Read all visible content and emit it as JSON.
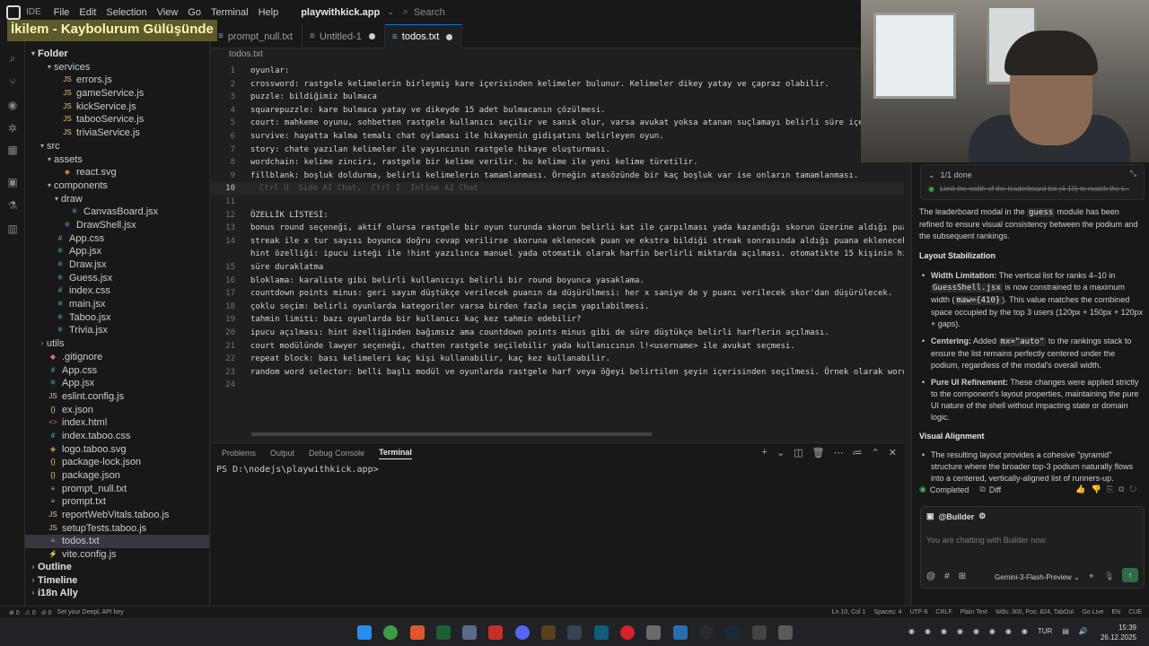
{
  "titlebar": {
    "ide_label": "IDE",
    "menus": [
      "File",
      "Edit",
      "Selection",
      "View",
      "Go",
      "Terminal",
      "Help"
    ],
    "project": "playwithkick.app",
    "search_placeholder": "Search"
  },
  "banner": "İkilem - Kaybolurum Gülüşünde",
  "sidebar": {
    "header": "Explorer",
    "folder_root": "Folder",
    "items": [
      {
        "label": "services",
        "kind": "folder-open",
        "indent": 1
      },
      {
        "label": "errors.js",
        "kind": "js",
        "indent": 2
      },
      {
        "label": "gameService.js",
        "kind": "js",
        "indent": 2
      },
      {
        "label": "kickService.js",
        "kind": "js",
        "indent": 2
      },
      {
        "label": "tabooService.js",
        "kind": "js",
        "indent": 2
      },
      {
        "label": "triviaService.js",
        "kind": "js",
        "indent": 2
      },
      {
        "label": "src",
        "kind": "folder-open",
        "indent": 0
      },
      {
        "label": "assets",
        "kind": "folder-open",
        "indent": 1
      },
      {
        "label": "react.svg",
        "kind": "svg",
        "indent": 2
      },
      {
        "label": "components",
        "kind": "folder-open",
        "indent": 1
      },
      {
        "label": "draw",
        "kind": "folder-open",
        "indent": 2
      },
      {
        "label": "CanvasBoard.jsx",
        "kind": "jsx",
        "indent": 3
      },
      {
        "label": "DrawShell.jsx",
        "kind": "jsx",
        "indent": 2
      },
      {
        "label": "App.css",
        "kind": "css",
        "indent": 1
      },
      {
        "label": "App.jsx",
        "kind": "jsx",
        "indent": 1
      },
      {
        "label": "Draw.jsx",
        "kind": "jsx",
        "indent": 1
      },
      {
        "label": "Guess.jsx",
        "kind": "jsx",
        "indent": 1
      },
      {
        "label": "index.css",
        "kind": "css",
        "indent": 1
      },
      {
        "label": "main.jsx",
        "kind": "jsx",
        "indent": 1
      },
      {
        "label": "Taboo.jsx",
        "kind": "jsx",
        "indent": 1
      },
      {
        "label": "Trivia.jsx",
        "kind": "jsx",
        "indent": 1
      },
      {
        "label": "utils",
        "kind": "folder-closed",
        "indent": 0
      },
      {
        "label": ".gitignore",
        "kind": "git",
        "indent": 0
      },
      {
        "label": "App.css",
        "kind": "css",
        "indent": 0
      },
      {
        "label": "App.jsx",
        "kind": "jsx",
        "indent": 0
      },
      {
        "label": "eslint.config.js",
        "kind": "js",
        "indent": 0
      },
      {
        "label": "ex.json",
        "kind": "json",
        "indent": 0
      },
      {
        "label": "index.html",
        "kind": "html",
        "indent": 0
      },
      {
        "label": "index.taboo.css",
        "kind": "css",
        "indent": 0
      },
      {
        "label": "logo.taboo.svg",
        "kind": "svg",
        "indent": 0
      },
      {
        "label": "package-lock.json",
        "kind": "json",
        "indent": 0
      },
      {
        "label": "package.json",
        "kind": "json",
        "indent": 0
      },
      {
        "label": "prompt_null.txt",
        "kind": "txt",
        "indent": 0
      },
      {
        "label": "prompt.txt",
        "kind": "txt",
        "indent": 0
      },
      {
        "label": "reportWebVitals.taboo.js",
        "kind": "js",
        "indent": 0
      },
      {
        "label": "setupTests.taboo.js",
        "kind": "js",
        "indent": 0
      },
      {
        "label": "todos.txt",
        "kind": "txt",
        "indent": 0,
        "selected": true
      },
      {
        "label": "vite.config.js",
        "kind": "vite",
        "indent": 0
      }
    ],
    "sections": [
      "Outline",
      "Timeline",
      "i18n Ally"
    ]
  },
  "tabs": [
    {
      "label": "prompt_null.txt",
      "active": false,
      "dirty": false
    },
    {
      "label": "Untitled-1",
      "active": false,
      "dirty": true
    },
    {
      "label": "todos.txt",
      "active": true,
      "dirty": true
    }
  ],
  "breadcrumb": "todos.txt",
  "editor": {
    "current_line": 10,
    "lines": [
      "oyunlar:",
      "crossword: rastgele kelimelerin birleşmiş kare içerisinden kelimeler bulunur. Kelimeler dikey yatay ve çapraz olabilir.",
      "puzzle: bildiğimiz bulmaca",
      "squarepuzzle: kare bulmaca yatay ve dikeyde 15 adet bulmacanın çözülmesi.",
      "court: mahkeme oyunu, sohbetten rastgele kullanıcı seçilir ve sanık olur, varsa avukat yoksa atanan suçlamayı belirli süre içerisinde",
      "survive: hayatta kalma temalı chat oylaması ile hikayenin gidişatını belirleyen oyun.",
      "story: chate yazılan kelimeler ile yayıncının rastgele hikaye oluşturması.",
      "wordchain: kelime zinciri, rastgele bir kelime verilir. bu kelime ile yeni kelime türetilir.",
      "fillblank: boşluk doldurma, belirli kelimelerin tamamlanması. Örneğin atasözünde bir kaç boşluk var ise onların tamamlanması.",
      "",
      "",
      "ÖZELLİK LİSTESİ:",
      "bonus round seçeneği, aktif olursa rastgele bir oyun turunda skorun belirli kat ile çarpılması yada kazandığı skorun üzerine aldığı puan ile",
      "streak ile x tur sayısı boyunca doğru cevap verilirse skoruna eklenecek puan ve ekstra bildiği streak sonrasında aldığı puana eklenecek; 3 round",
      "hint özelliği: ipucu isteği ile !hint yazılınca manuel yada otomatik olarak harfin berlirli miktarda açılması. otomatikte 15 kişinin hint yazması",
      "süre duraklatma",
      "bloklama: karaliste gibi belirli kullanıcıyı belirli bir round boyunca yasaklama.",
      "countdown points minus: geri sayım düştükçe verilecek puanın da düşürülmesi: her x saniye de y puanı verilecek skor'dan düşürülecek.",
      "çoklu seçim: belirli oyunlarda kategoriler varsa birden fazla seçim yapılabilmesi.",
      "tahmin limiti: bazı oyunlarda bir kullanıcı kaç kez tahmin edebilir?",
      "ipucu açılması: hint özelliğinden bağımsız ama countdown points minus gibi de süre düştükçe belirli harflerin açılması.",
      "court modülünde lawyer seçeneği, chatten rastgele seçilebilir yada kullanıcının l!<username> ile avukat seçmesi.",
      "repeat block: bası kelimeleri kaç kişi kullanabilir, kaç kez kullanabilir.",
      "random word selector: belli başlı modül ve oyunlarda rastgele harf veya öğeyi belirtilen şeyin içerisinden seçilmesi. Örnek olarak wordchain",
      ""
    ],
    "line_numbers": [
      "1",
      "2",
      "3",
      "4",
      "5",
      "6",
      "7",
      "8",
      "9",
      "10",
      "11",
      "12",
      "13",
      "14",
      "",
      "15",
      "16",
      "17",
      "18",
      "19",
      "20",
      "21",
      "22",
      "23",
      "24",
      "25"
    ],
    "inline_hint": "Ctrl U  Side AI Chat,  Ctrl I  Inline AI Chat"
  },
  "panel": {
    "tabs": [
      "Problems",
      "Output",
      "Debug Console",
      "Terminal"
    ],
    "active_tab": "Terminal",
    "terminal_prompt": "PS D:\\nodejs\\playwithkick.app>"
  },
  "chat": {
    "todo_header": "1/1 done",
    "todo_item": "Limit the width of the leaderboard list (4-10) to match the t...",
    "intro_pre": "The leaderboard modal in the ",
    "intro_code": "guess",
    "intro_post": " module has been refined to ensure visual consistency between the podium and the subsequent rankings.",
    "section1": "Layout Stabilization",
    "b1_title": "Width Limitation:",
    "b1_pre": " The vertical list for ranks 4–10 in ",
    "b1_code": "GuessShell.jsx",
    "b1_mid": " is now constrained to a maximum width (",
    "b1_code2": "maw={410}",
    "b1_post": "). This value matches the combined space occupied by the top 3 users (120px + 150px + 120px + gaps).",
    "b2_title": "Centering:",
    "b2_pre": " Added ",
    "b2_code": "mx=\"auto\"",
    "b2_post": " to the rankings stack to ensure the list remains perfectly centered under the podium, regardless of the modal's overall width.",
    "b3_title": "Pure UI Refinement:",
    "b3_text": " These changes were applied strictly to the component's layout properties, maintaining the pure UI nature of the shell without impacting state or domain logic.",
    "section2": "Visual Alignment",
    "b4_text": "The resulting layout provides a cohesive \"pyramid\" structure where the broader top-3 podium naturally flows into a centered, vertically-aligned list of runners-up.",
    "status_completed": "Completed",
    "status_diff": "Diff",
    "agent_name": "@Builder",
    "composer_placeholder": "You are chatting with Builder now",
    "model": "Gemini-3-Flash-Preview"
  },
  "statusbar": {
    "left": [
      "⊗ 0",
      "⚠ 0",
      "⊘ 0",
      "Set your DeepL API key"
    ],
    "right": [
      "Ln 10, Col 1",
      "Spaces: 4",
      "UTF-8",
      "CRLF",
      "Plain Text",
      "Wds: 300, Pos: 824, TabOut",
      "Go Live",
      "EN",
      "CUE"
    ]
  },
  "taskbar": {
    "lang": "TUR",
    "time": "15:39",
    "date": "26.12.2025"
  },
  "colors": {
    "accent": "#0078d4",
    "editor_bg": "#1f1f1f",
    "sidebar_bg": "#181818",
    "selected_row": "#37373d",
    "banner_bg": "#5b5a2c"
  }
}
